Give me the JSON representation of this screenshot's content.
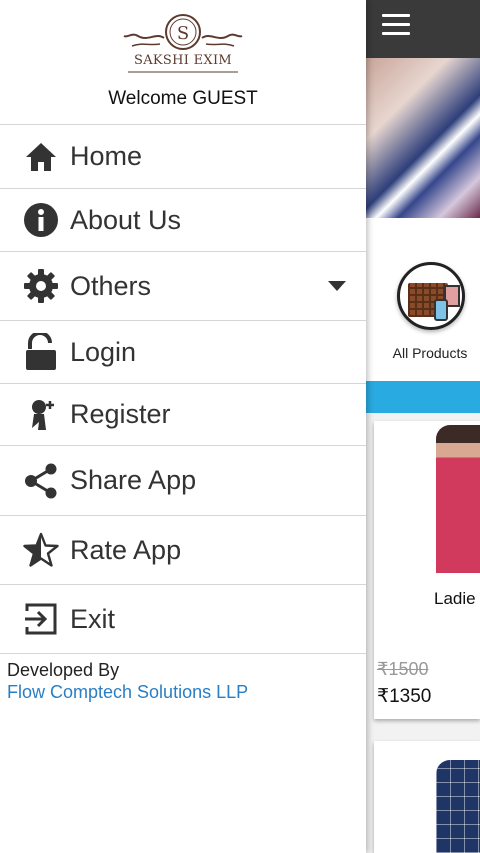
{
  "app": {
    "category": {
      "label": "All Products"
    },
    "product": {
      "title": "Ladie",
      "old_price": "₹1500",
      "new_price": "₹1350"
    }
  },
  "drawer": {
    "brand": "SAKSHI EXIM",
    "welcome": "Welcome GUEST",
    "items": [
      {
        "label": "Home",
        "icon": "home-icon"
      },
      {
        "label": "About Us",
        "icon": "info-icon"
      },
      {
        "label": "Others",
        "icon": "gear-icon",
        "expandable": true
      },
      {
        "label": "Login",
        "icon": "lock-open-icon"
      },
      {
        "label": "Register",
        "icon": "add-user-icon"
      },
      {
        "label": "Share App",
        "icon": "share-icon"
      },
      {
        "label": "Rate App",
        "icon": "star-icon"
      },
      {
        "label": "Exit",
        "icon": "exit-icon"
      }
    ],
    "footer": {
      "developed_by": "Developed By",
      "company": "Flow Comptech Solutions LLP"
    }
  },
  "colors": {
    "topbar": "#3a3a3a",
    "accent_strip": "#29aae1",
    "link": "#2a7fc4",
    "logo": "#5c3b2e"
  }
}
